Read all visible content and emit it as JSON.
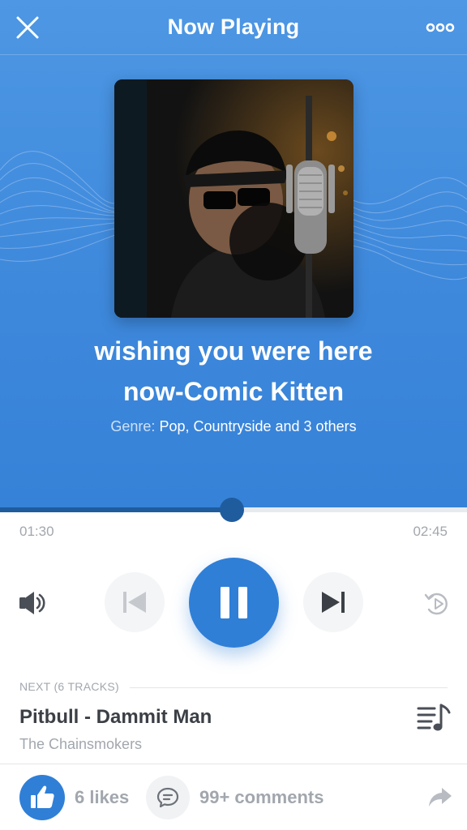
{
  "header": {
    "title": "Now Playing",
    "close_icon": "close-icon",
    "more_icon": "more-horizontal-icon"
  },
  "now_playing": {
    "title_line1": "wishing you were here",
    "title_line2": "now-Comic Kitten",
    "genre_label": "Genre:",
    "genre_value": "Pop, Countryside and 3 others",
    "cover_image": "singer-with-studio-microphone"
  },
  "progress": {
    "elapsed": "01:30",
    "total": "02:45",
    "fraction": 0.498
  },
  "controls": {
    "volume_icon": "volume-icon",
    "previous_icon": "skip-previous-icon",
    "play_pause_icon": "pause-icon",
    "next_icon": "skip-next-icon",
    "repeat_icon": "replay-icon"
  },
  "up_next": {
    "label": "NEXT (6 TRACKS)",
    "track_title": "Pitbull - Dammit Man",
    "artist": "The Chainsmokers",
    "queue_icon": "playlist-music-icon"
  },
  "social": {
    "likes": "6 likes",
    "comments": "99+ comments",
    "like_icon": "thumbs-up-icon",
    "comment_icon": "comment-icon",
    "share_icon": "share-icon"
  },
  "colors": {
    "hero_gradient_top": "#4d97e4",
    "hero_gradient_bottom": "#3582d8",
    "accent": "#2f7fd7",
    "progress": "#1f5c9e",
    "muted_text": "#a2a7ae",
    "dark_text": "#3c4046"
  }
}
